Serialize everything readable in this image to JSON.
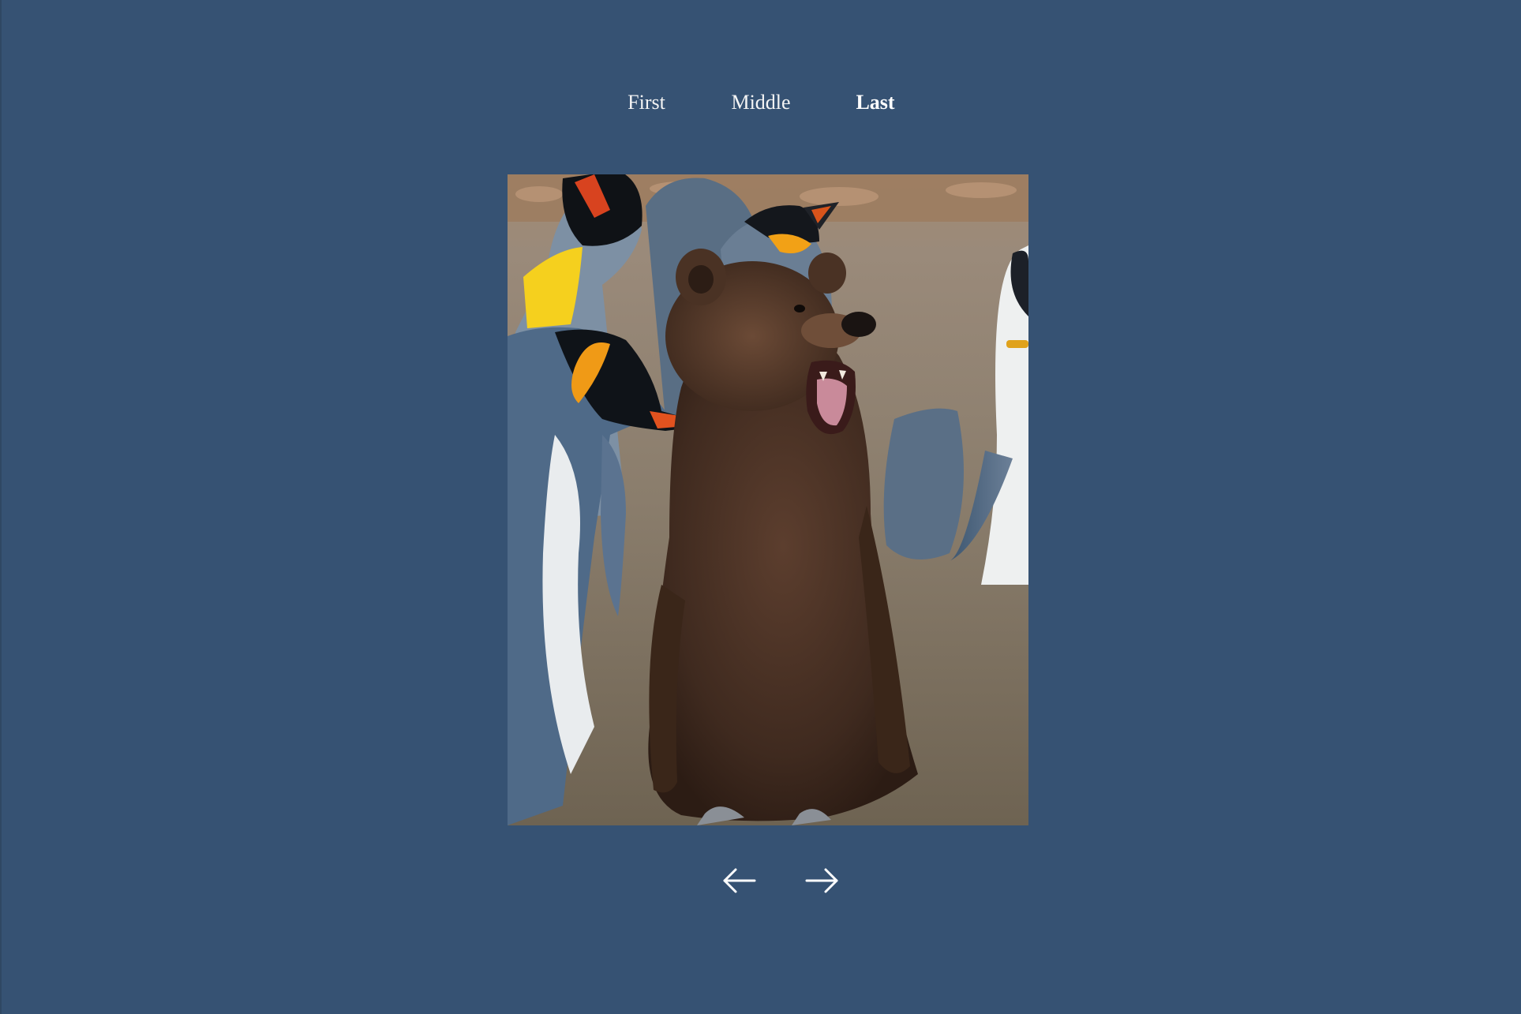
{
  "nav": {
    "items": [
      {
        "label": "First",
        "active": false
      },
      {
        "label": "Middle",
        "active": false
      },
      {
        "label": "Last",
        "active": true
      }
    ]
  },
  "slide": {
    "image": "photo-of-brown-bear-head-on-king-penguin-chick-body-among-king-penguins"
  },
  "controls": {
    "prev_icon": "left-arrow-icon",
    "next_icon": "right-arrow-icon"
  },
  "colors": {
    "background": "#365273",
    "text": "#ffffff"
  }
}
